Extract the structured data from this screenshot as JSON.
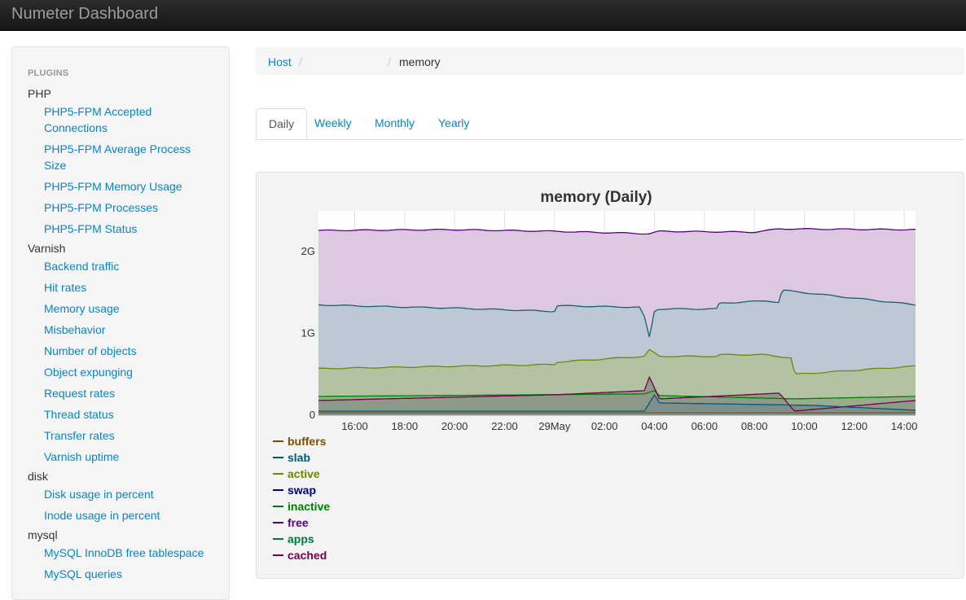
{
  "app": {
    "title": "Numeter Dashboard"
  },
  "sidebar": {
    "header": "PLUGINS",
    "groups": [
      {
        "label": "PHP",
        "items": [
          "PHP5-FPM Accepted Connections",
          "PHP5-FPM Average Process Size",
          "PHP5-FPM Memory Usage",
          "PHP5-FPM Processes",
          "PHP5-FPM Status"
        ]
      },
      {
        "label": "Varnish",
        "items": [
          "Backend traffic",
          "Hit rates",
          "Memory usage",
          "Misbehavior",
          "Number of objects",
          "Object expunging",
          "Request rates",
          "Thread status",
          "Transfer rates",
          "Varnish uptime"
        ]
      },
      {
        "label": "disk",
        "items": [
          "Disk usage in percent",
          "Inode usage in percent"
        ]
      },
      {
        "label": "mysql",
        "items": [
          "MySQL InnoDB free tablespace",
          "MySQL queries"
        ]
      }
    ]
  },
  "breadcrumb": {
    "host": "Host",
    "separator": "/",
    "current": "memory"
  },
  "tabs": [
    "Daily",
    "Weekly",
    "Monthly",
    "Yearly"
  ],
  "chart_data": {
    "type": "area",
    "title": "memory (Daily)",
    "y_ticks": [
      "0",
      "1G",
      "2G"
    ],
    "x_ticks": [
      "16:00",
      "18:00",
      "20:00",
      "22:00",
      "29May",
      "02:00",
      "04:00",
      "06:00",
      "08:00",
      "10:00",
      "12:00",
      "14:00"
    ],
    "x_hours": [
      16,
      18,
      20,
      22,
      24,
      26,
      28,
      30,
      32,
      34,
      36,
      38
    ],
    "x_range_hours": [
      14.55,
      38.45
    ],
    "y_range_gb": [
      0,
      2.5
    ],
    "stacked": true,
    "series": [
      {
        "name": "buffers",
        "color": "#7a4f00",
        "points": [
          [
            14.55,
            0.03
          ],
          [
            38.45,
            0.03
          ]
        ]
      },
      {
        "name": "slab",
        "color": "#005a73",
        "points": [
          [
            14.55,
            0.05
          ],
          [
            27.6,
            0.05
          ],
          [
            28.0,
            0.25
          ],
          [
            28.2,
            0.15
          ],
          [
            34.4,
            0.12
          ],
          [
            38.45,
            0.06
          ]
        ]
      },
      {
        "name": "active",
        "color": "#6c8a00",
        "points": [
          [
            14.55,
            0.57
          ],
          [
            24,
            0.62
          ],
          [
            24.1,
            0.65
          ],
          [
            27.6,
            0.72
          ],
          [
            27.8,
            0.8
          ],
          [
            28.2,
            0.72
          ],
          [
            30.5,
            0.72
          ],
          [
            30.6,
            0.74
          ],
          [
            32.4,
            0.74
          ],
          [
            33.5,
            0.7
          ],
          [
            33.6,
            0.5
          ],
          [
            38.45,
            0.6
          ]
        ]
      },
      {
        "name": "swap",
        "color": "#000080",
        "points": [
          [
            14.55,
            0.0
          ],
          [
            38.45,
            0.0
          ]
        ]
      },
      {
        "name": "inactive",
        "color": "#008000",
        "points": [
          [
            14.55,
            0.23
          ],
          [
            27.6,
            0.26
          ],
          [
            28.0,
            0.3
          ],
          [
            28.2,
            0.24
          ],
          [
            33.6,
            0.2
          ],
          [
            38.45,
            0.23
          ]
        ]
      },
      {
        "name": "free",
        "color": "#5c0080",
        "points": [
          [
            14.55,
            2.26
          ],
          [
            20,
            2.27
          ],
          [
            24,
            2.25
          ],
          [
            27.8,
            2.22
          ],
          [
            28.2,
            2.25
          ],
          [
            32,
            2.24
          ],
          [
            33.0,
            2.28
          ],
          [
            38.45,
            2.27
          ]
        ]
      },
      {
        "name": "apps",
        "color": "#007a3d",
        "points": [
          [
            14.55,
            0.2
          ],
          [
            38.45,
            0.2
          ]
        ]
      },
      {
        "name": "cached",
        "color": "#73004d",
        "points": [
          [
            14.55,
            0.18
          ],
          [
            24,
            0.25
          ],
          [
            27.6,
            0.3
          ],
          [
            27.8,
            0.47
          ],
          [
            28.2,
            0.2
          ],
          [
            33.0,
            0.27
          ],
          [
            33.6,
            0.05
          ],
          [
            38.45,
            0.18
          ]
        ]
      }
    ],
    "used_line": {
      "color": "#1a6070",
      "points": [
        [
          14.55,
          1.35
        ],
        [
          17,
          1.33
        ],
        [
          20,
          1.31
        ],
        [
          24,
          1.27
        ],
        [
          24.1,
          1.34
        ],
        [
          27.4,
          1.32
        ],
        [
          27.6,
          1.2
        ],
        [
          27.8,
          0.95
        ],
        [
          28.0,
          1.28
        ],
        [
          28.2,
          1.3
        ],
        [
          30.5,
          1.3
        ],
        [
          30.6,
          1.37
        ],
        [
          32.5,
          1.4
        ],
        [
          33.0,
          1.38
        ],
        [
          33.1,
          1.53
        ],
        [
          38.45,
          1.35
        ]
      ]
    },
    "legend": [
      "buffers",
      "slab",
      "active",
      "swap",
      "inactive",
      "free",
      "apps",
      "cached"
    ]
  }
}
